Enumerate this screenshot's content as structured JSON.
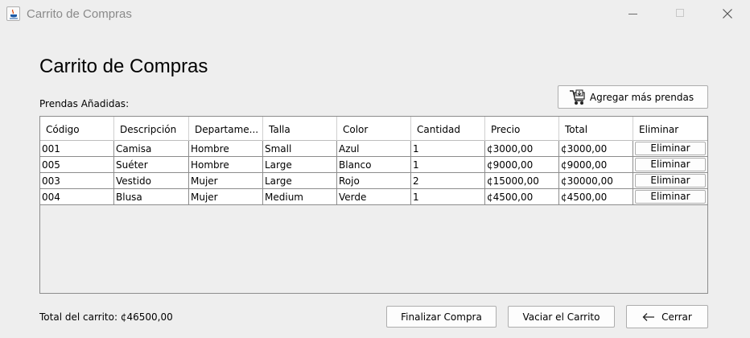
{
  "window": {
    "title": "Carrito de Compras"
  },
  "page": {
    "title": "Carrito de Compras",
    "items_label": "Prendas Añadidas:",
    "add_more_label": "Agregar más prendas"
  },
  "table": {
    "headers": [
      "Código",
      "Descripción",
      "Departame...",
      "Talla",
      "Color",
      "Cantidad",
      "Precio",
      "Total",
      "Eliminar"
    ],
    "rows": [
      {
        "codigo": "001",
        "descripcion": "Camisa",
        "departamento": "Hombre",
        "talla": "Small",
        "color": "Azul",
        "cantidad": "1",
        "precio": "¢3000,00",
        "total": "¢3000,00",
        "eliminar": "Eliminar"
      },
      {
        "codigo": "005",
        "descripcion": "Suéter",
        "departamento": "Hombre",
        "talla": "Large",
        "color": "Blanco",
        "cantidad": "1",
        "precio": "¢9000,00",
        "total": "¢9000,00",
        "eliminar": "Eliminar"
      },
      {
        "codigo": "003",
        "descripcion": "Vestido",
        "departamento": "Mujer",
        "talla": "Large",
        "color": "Rojo",
        "cantidad": "2",
        "precio": "¢15000,00",
        "total": "¢30000,00",
        "eliminar": "Eliminar"
      },
      {
        "codigo": "004",
        "descripcion": "Blusa",
        "departamento": "Mujer",
        "talla": "Medium",
        "color": "Verde",
        "cantidad": "1",
        "precio": "¢4500,00",
        "total": "¢4500,00",
        "eliminar": "Eliminar"
      }
    ]
  },
  "footer": {
    "total_text": "Total del carrito: ¢46500,00",
    "finalize_label": "Finalizar Compra",
    "clear_label": "Vaciar el Carrito",
    "close_label": "Cerrar"
  },
  "icons": {
    "app": "java-cup-icon",
    "add_more": "shopping-cart-icon",
    "close": "arrow-left-icon"
  }
}
